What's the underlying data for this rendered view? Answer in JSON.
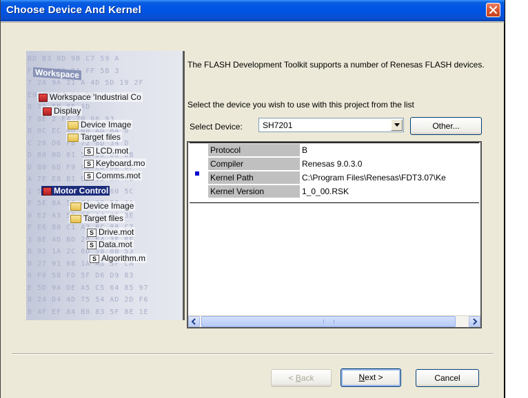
{
  "window": {
    "title": "Choose Device And Kernel"
  },
  "illustration": {
    "hex_rows": [
      "BD B3 8D 9B C7 59 A",
      "FA 28 40 DA FF 5B 3",
      "7 2A 9A 21 A 4D 5D 19 2F",
      "E9 E5 E7 09 DD",
      "8 70 EB 8E AD",
      "7 8E 2 F4 70 06 93",
      "B 0C EC 4D 00 AD BA 0",
      "C 20 D6 F8 72 8D 34 D",
      "D 80 0D 01 5A 00 00 BB",
      "D 80 6D F9 90 C8 0D 8F",
      "A 7E E8 B1 ED 33 9A 78",
      "1 5E 8A 33 47 69 60 5C",
      "E 5E 8A 58 C4 3E 5E 31",
      "0 E2 A3 57 B6 A4 4F 3E",
      "F E6 80 C1 A3 BC 88 C7",
      "3 8E 4D BD 2B E4 3E BF",
      "B 92 1A 2C 0D 58 8B 53",
      "B 27 91 08 1A A8 5F CA",
      "6 F0 58 FD 5F D6 D9 83",
      "E 5D 9A DE A5 C5 64 85 97",
      "8 24 D4 4D 75 54 AD 2D F6",
      "B 4F EF 84 B0 83 5F 8E 1E"
    ],
    "workspace_label": "Workspace",
    "tree": [
      {
        "label": "Workspace 'Industrial Co",
        "icon": "workspace-icon"
      },
      {
        "label": "Display",
        "icon": "project-icon"
      },
      {
        "label": "Device Image",
        "icon": "folder-icon"
      },
      {
        "label": "Target files",
        "icon": "folder-icon"
      },
      {
        "label": "LCD.mot",
        "icon": "file-icon"
      },
      {
        "label": "Keyboard.mo",
        "icon": "file-icon"
      },
      {
        "label": "Comms.mot",
        "icon": "file-icon"
      },
      {
        "label": "Motor Control",
        "icon": "project-icon"
      },
      {
        "label": "Device Image",
        "icon": "folder-icon"
      },
      {
        "label": "Target files",
        "icon": "folder-icon"
      },
      {
        "label": "Drive.mot",
        "icon": "file-icon"
      },
      {
        "label": "Data.mot",
        "icon": "file-icon"
      },
      {
        "label": "Algorithm.m",
        "icon": "file-icon"
      }
    ],
    "file_icon_glyph": "S"
  },
  "content": {
    "description": "The FLASH Development Toolkit supports a number of Renesas FLASH devices.",
    "instruction": "Select the device you wish to use with this project from the list",
    "select_label": "Select Device:",
    "selected_device": "SH7201",
    "other_button": "Other..."
  },
  "device_table": {
    "rows": [
      {
        "key": "Protocol",
        "value": "B"
      },
      {
        "key": "Compiler",
        "value": "Renesas 9.0.3.0"
      },
      {
        "key": "Kernel Path",
        "value": "C:\\Program Files\\Renesas\\FDT3.07\\Ke"
      },
      {
        "key": "Kernel Version",
        "value": "1_0_00.RSK"
      }
    ]
  },
  "footer": {
    "back_pre": "< ",
    "back_hot": "B",
    "back_post": "ack",
    "next_hot": "N",
    "next_post": "ext >",
    "cancel": "Cancel"
  },
  "colors": {
    "title_blue": "#0054e3",
    "dialog_bg": "#ece9d8",
    "close_red": "#d8542d",
    "marker_blue": "#0000cc"
  }
}
